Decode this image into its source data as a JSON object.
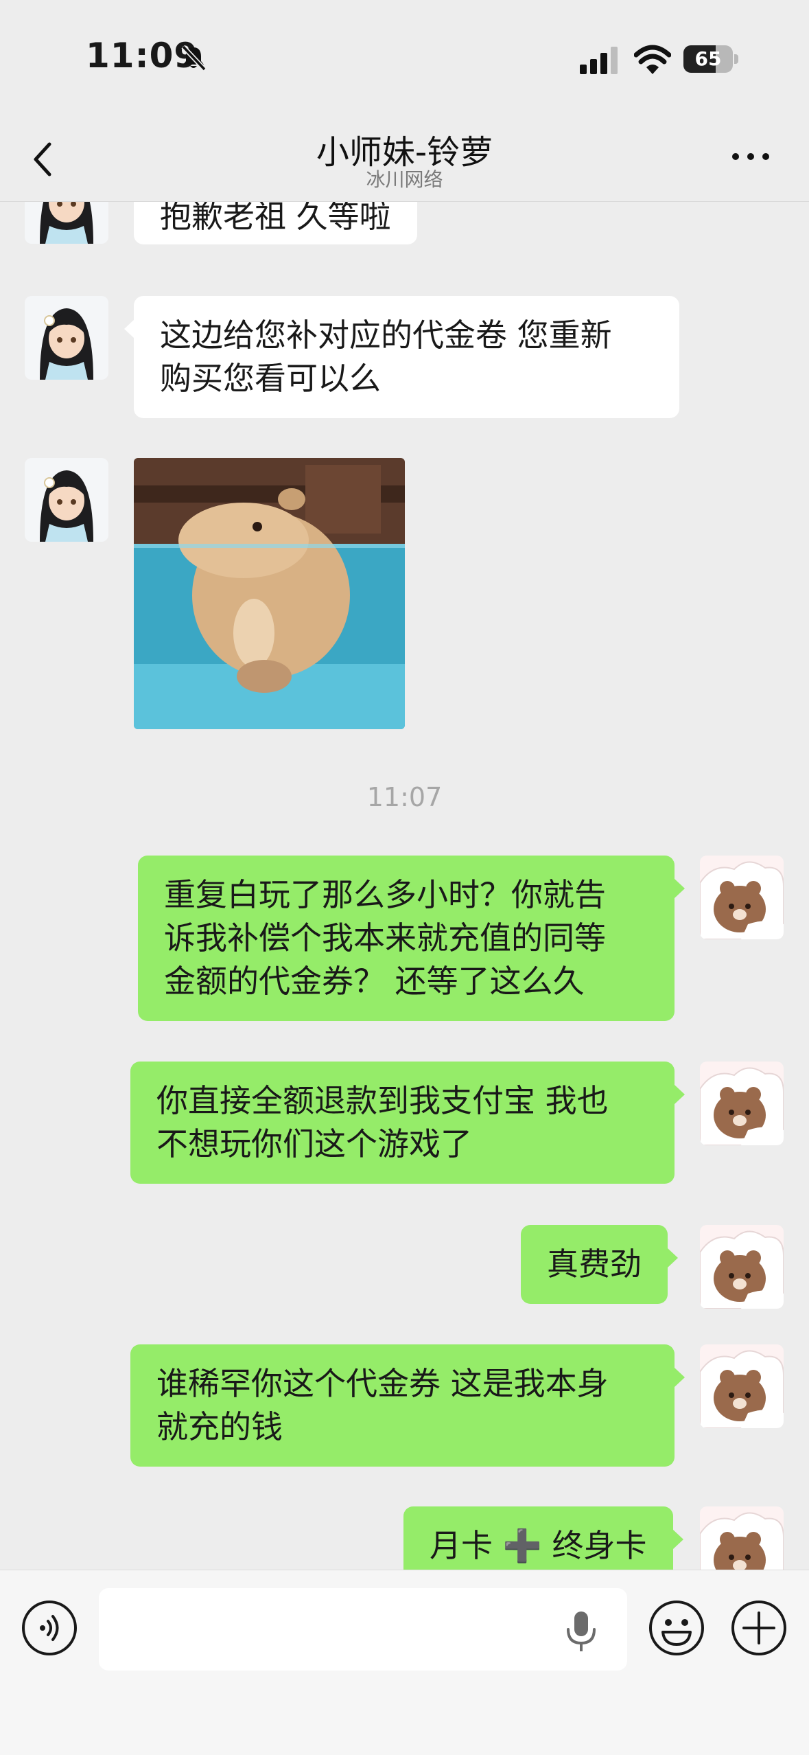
{
  "status_bar": {
    "time": "11:09",
    "battery_level": 65,
    "battery_text": "65",
    "icons": [
      "bell-slash-icon",
      "signal-icon",
      "wifi-icon",
      "battery-icon"
    ]
  },
  "nav": {
    "title": "小师妹-铃萝",
    "subtitle": "冰川网络",
    "back_icon": "chevron-left-icon",
    "more_icon": "more-dots-icon"
  },
  "messages": [
    {
      "side": "left",
      "type": "text",
      "text": "抱歉老祖 久等啦"
    },
    {
      "side": "left",
      "type": "text",
      "lines": [
        "这边给您补对应的代金卷 您重新",
        "购买您看可以么"
      ]
    },
    {
      "side": "left",
      "type": "image",
      "content": "capybara-sticker"
    },
    {
      "type": "timestamp",
      "text": "11:07"
    },
    {
      "side": "right",
      "type": "text",
      "lines": [
        "重复白玩了那么多小时？你就告",
        "诉我补偿个我本来就充值的同等",
        "金额的代金券？ 还等了这么久"
      ]
    },
    {
      "side": "right",
      "type": "text",
      "lines": [
        "你直接全额退款到我支付宝 我也",
        "不想玩你们这个游戏了"
      ]
    },
    {
      "side": "right",
      "type": "text",
      "text": "真费劲"
    },
    {
      "side": "right",
      "type": "text",
      "lines": [
        "谁稀罕你这个代金券 这是我本身",
        "就充的钱"
      ]
    },
    {
      "side": "right",
      "type": "text",
      "text": "月卡 ➕ 终身卡"
    }
  ],
  "input_bar": {
    "placeholder": "",
    "icons": [
      "voice-icon",
      "mic-icon",
      "emoji-icon",
      "plus-icon"
    ]
  },
  "colors": {
    "background": "#ededed",
    "bubble_self": "#95ec69",
    "bubble_other": "#ffffff",
    "timestamp": "#a6a6a6"
  }
}
